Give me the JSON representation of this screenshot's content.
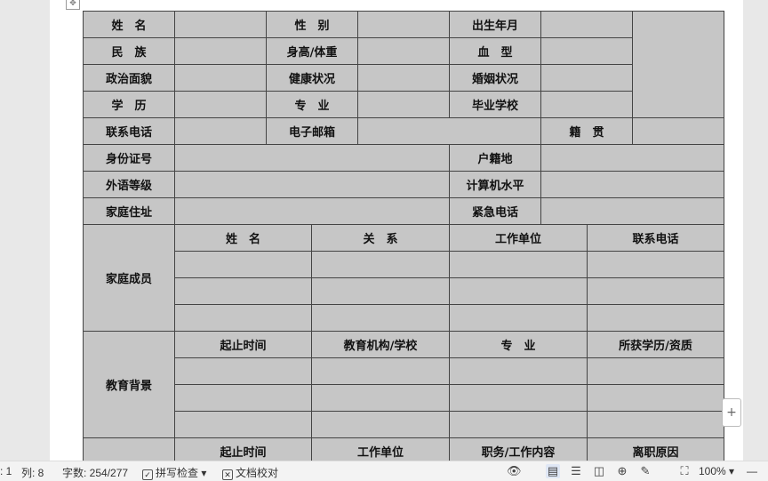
{
  "form": {
    "name_label": "姓　名",
    "gender_label": "性　别",
    "birth_label": "出生年月",
    "ethnicity_label": "民　族",
    "height_weight_label": "身高/体重",
    "blood_label": "血　型",
    "political_label": "政治面貌",
    "health_label": "健康状况",
    "marital_label": "婚姻状况",
    "education_label": "学　历",
    "major_label": "专　业",
    "school_label": "毕业学校",
    "phone_label": "联系电话",
    "email_label": "电子邮箱",
    "native_label": "籍　贯",
    "id_label": "身份证号",
    "hukou_label": "户籍地",
    "language_label": "外语等级",
    "computer_label": "计算机水平",
    "address_label": "家庭住址",
    "emergency_label": "紧急电话",
    "family": {
      "title": "家庭成员",
      "headers": [
        "姓　名",
        "关　系",
        "工作单位",
        "联系电话"
      ]
    },
    "edu": {
      "title": "教育背景",
      "headers": [
        "起止时间",
        "教育机构/学校",
        "专　业",
        "所获学历/资质"
      ]
    },
    "work": {
      "headers": [
        "起止时间",
        "工作单位",
        "职务/工作内容",
        "离职原因"
      ]
    }
  },
  "add_button": "+",
  "statusbar": {
    "page": ": 1",
    "col": "列: 8",
    "wordcount": "字数: 254/277",
    "spellcheck": "拼写检查",
    "proofread": "文档校对",
    "zoom": "100%"
  },
  "icons": [
    "eye-icon",
    "page-view-icon",
    "outline-icon",
    "book-icon",
    "web-icon",
    "pen-icon",
    "fit-icon"
  ]
}
